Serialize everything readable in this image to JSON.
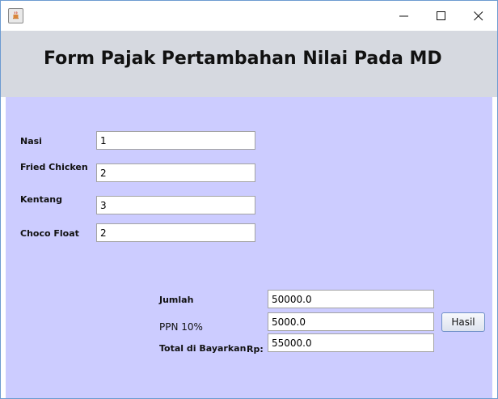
{
  "window": {
    "controls": {
      "minimize": "minimize",
      "maximize": "maximize",
      "close": "close"
    }
  },
  "header": {
    "title": "Form Pajak Pertambahan Nilai Pada MD"
  },
  "items": [
    {
      "label": "Nasi",
      "value": "1"
    },
    {
      "label": "Fried Chicken",
      "value": "2"
    },
    {
      "label": "Kentang",
      "value": "3"
    },
    {
      "label": "Choco Float",
      "value": "2"
    }
  ],
  "summary": {
    "jumlah_label": "Jumlah",
    "jumlah_value": "50000.0",
    "ppn_label": "PPN 10%",
    "ppn_value": "5000.0",
    "total_label": "Total di Bayarkan",
    "total_currency": "Rp:",
    "total_value": "55000.0",
    "hasil_button": "Hasil"
  },
  "colors": {
    "panel": "#ccccff",
    "header": "#d6d9e0"
  }
}
